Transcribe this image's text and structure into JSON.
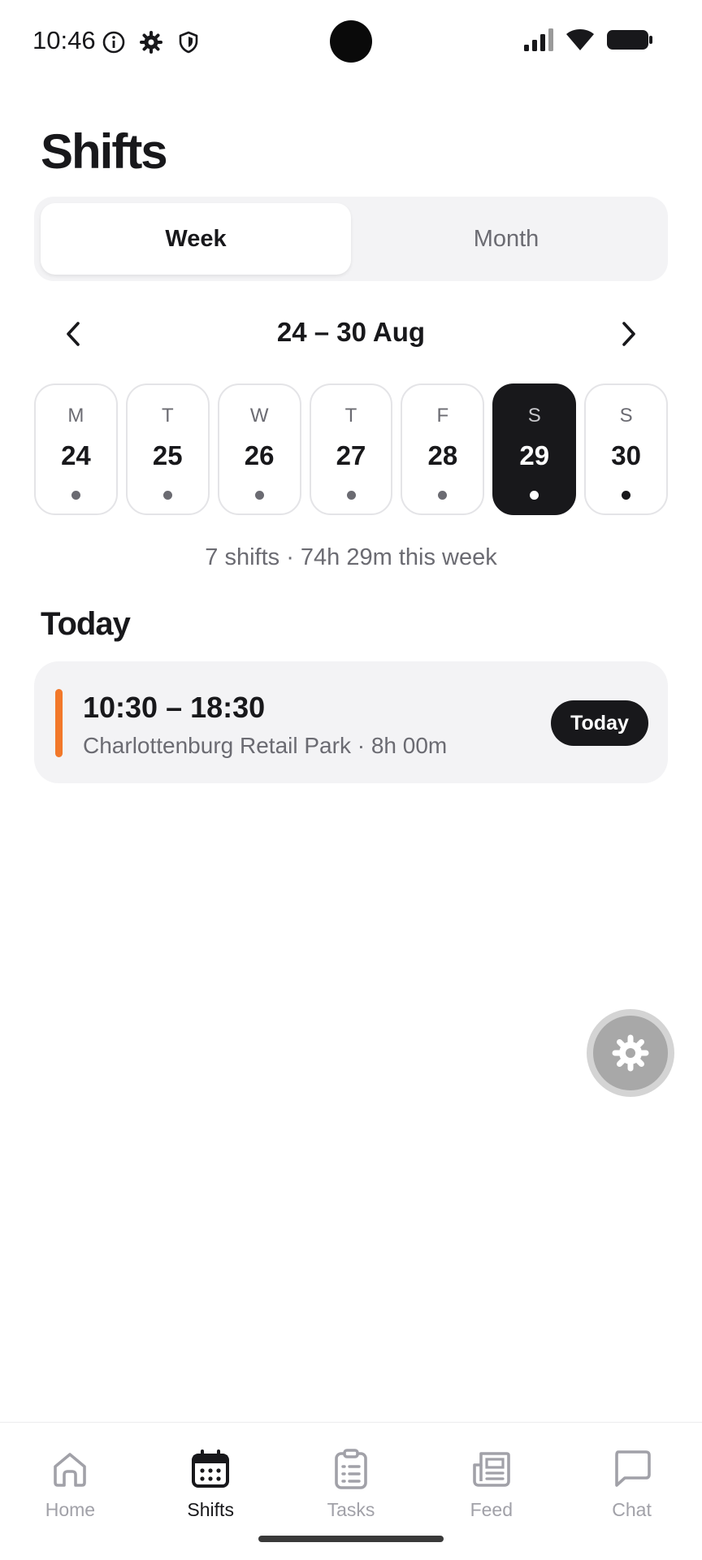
{
  "status_bar": {
    "time": "10:46",
    "left_icons": [
      "info-icon",
      "gear-icon",
      "shield-icon"
    ],
    "right_icons": [
      "signal-icon",
      "wifi-icon",
      "battery-icon"
    ]
  },
  "page": {
    "title": "Shifts"
  },
  "view_toggle": {
    "options": [
      {
        "label": "Week",
        "selected": true
      },
      {
        "label": "Month",
        "selected": false
      }
    ]
  },
  "week_nav": {
    "range": "24 – 30 Aug",
    "prev_icon": "chevron-left-icon",
    "next_icon": "chevron-right-icon"
  },
  "days": [
    {
      "dow": "M",
      "date": "24",
      "selected": false
    },
    {
      "dow": "T",
      "date": "25",
      "selected": false
    },
    {
      "dow": "W",
      "date": "26",
      "selected": false
    },
    {
      "dow": "T",
      "date": "27",
      "selected": false
    },
    {
      "dow": "F",
      "date": "28",
      "selected": false
    },
    {
      "dow": "S",
      "date": "29",
      "selected": true
    },
    {
      "dow": "S",
      "date": "30",
      "selected": false
    }
  ],
  "week_summary": "7 shifts · 74h 29m this week",
  "today_section": {
    "title": "Today",
    "shift": {
      "time": "10:30 – 18:30",
      "meta": "Charlottenburg Retail Park · 8h 00m",
      "badge": "Today",
      "accent_color": "#f2782a"
    }
  },
  "fab": {
    "icon": "gear-icon"
  },
  "tab_bar": {
    "tabs": [
      {
        "label": "Home",
        "icon": "home-icon",
        "active": false
      },
      {
        "label": "Shifts",
        "icon": "calendar-icon",
        "active": true
      },
      {
        "label": "Tasks",
        "icon": "clipboard-icon",
        "active": false
      },
      {
        "label": "Feed",
        "icon": "newspaper-icon",
        "active": false
      },
      {
        "label": "Chat",
        "icon": "chat-icon",
        "active": false
      }
    ]
  },
  "colors": {
    "text_primary": "#18181b",
    "text_secondary": "#6b6b72",
    "accent": "#f2782a",
    "surface": "#f3f3f5"
  }
}
